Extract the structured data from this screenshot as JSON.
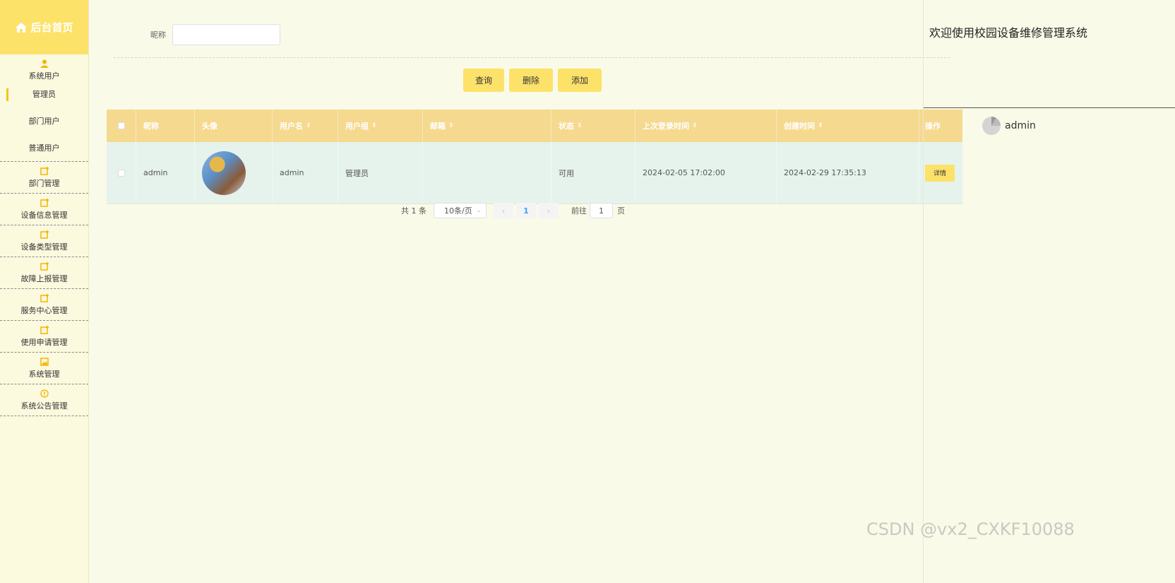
{
  "brand": "后台首页",
  "sidebar": {
    "system_user": "系统用户",
    "sub_items": [
      "管理员",
      "部门用户",
      "普通用户"
    ],
    "groups": [
      "部门管理",
      "设备信息管理",
      "设备类型管理",
      "故障上报管理",
      "服务中心管理",
      "使用申请管理",
      "系统管理",
      "系统公告管理"
    ]
  },
  "search": {
    "label": "昵称",
    "value": ""
  },
  "buttons": {
    "query": "查询",
    "delete": "删除",
    "add": "添加"
  },
  "table": {
    "headers": [
      "昵称",
      "头像",
      "用户名",
      "用户组",
      "邮箱",
      "状态",
      "上次登录时间",
      "创建时间",
      "操作"
    ],
    "rows": [
      {
        "nickname": "admin",
        "username": "admin",
        "group": "管理员",
        "email": "",
        "status": "可用",
        "last_login": "2024-02-05 17:02:00",
        "created": "2024-02-29 17:35:13",
        "action": "详情"
      }
    ]
  },
  "pager": {
    "total": "共 1 条",
    "page_size": "10条/页",
    "current": "1",
    "goto_label": "前往",
    "goto_value": "1",
    "page_suffix": "页"
  },
  "right": {
    "welcome": "欢迎使用校园设备维修管理系统",
    "user": "admin"
  },
  "watermark": "CSDN @vx2_CXKF10088",
  "colors": {
    "accent": "#fde269",
    "header": "#f5d98f",
    "background": "#fafae8",
    "row": "#e5f3ec"
  }
}
